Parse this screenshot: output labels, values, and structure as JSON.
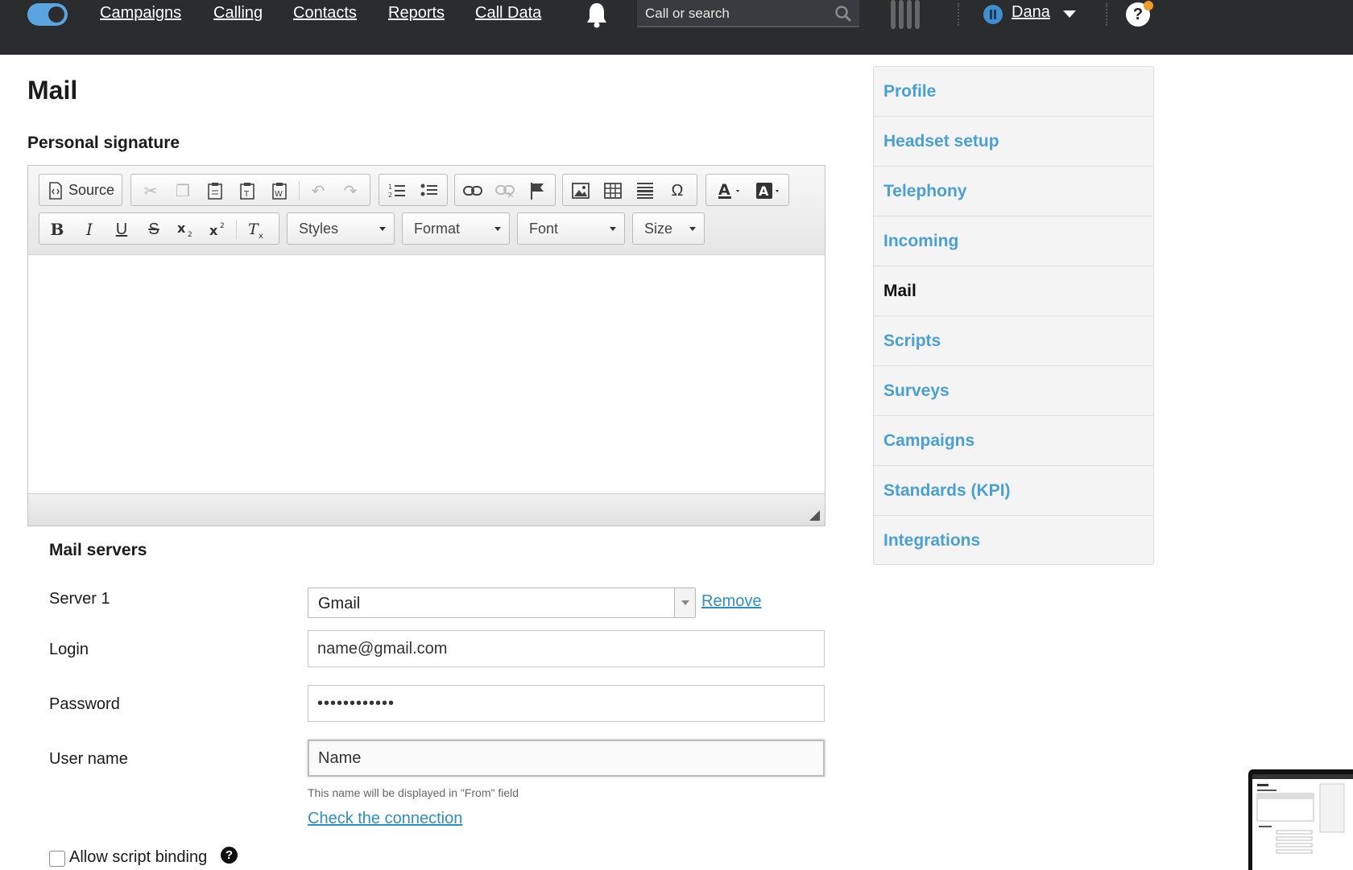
{
  "topbar": {
    "nav": [
      "Campaigns",
      "Calling",
      "Contacts",
      "Reports",
      "Call Data"
    ],
    "search_placeholder": "Call or search",
    "user": "Dana",
    "help": "?",
    "icons": [
      "toggle-icon",
      "bell-icon",
      "search-icon",
      "bars-icon",
      "status-icon",
      "chevron-down-icon",
      "help-icon"
    ]
  },
  "page": {
    "title": "Mail",
    "signature_title": "Personal signature"
  },
  "editor": {
    "source_label": "Source",
    "styles_label": "Styles",
    "format_label": "Format",
    "font_label": "Font",
    "size_label": "Size",
    "bold": "B",
    "italic": "I",
    "underline": "U",
    "strike": "S",
    "omega": "Ω"
  },
  "mail_servers": {
    "title": "Mail servers",
    "server_label": "Server 1",
    "server_value": "Gmail",
    "remove_label": "Remove",
    "login_label": "Login",
    "login_value": "name@gmail.com",
    "password_label": "Password",
    "password_value": "••••••••••••",
    "username_label": "User name",
    "username_value": "Name",
    "username_hint": "This name will be displayed in \"From\" field",
    "check_connection": "Check the connection",
    "allow_binding": "Allow script binding"
  },
  "side_menu": {
    "items": [
      "Profile",
      "Headset setup",
      "Telephony",
      "Incoming",
      "Mail",
      "Scripts",
      "Surveys",
      "Campaigns",
      "Standards (KPI)",
      "Integrations"
    ],
    "active": "Mail"
  },
  "colors": {
    "topbar_bg": "#2b2c2e",
    "accent_link": "#2e8fc4",
    "side_link": "#4aa0d2",
    "status_blue": "#3f8fd0",
    "notification": "#f09a2b"
  }
}
